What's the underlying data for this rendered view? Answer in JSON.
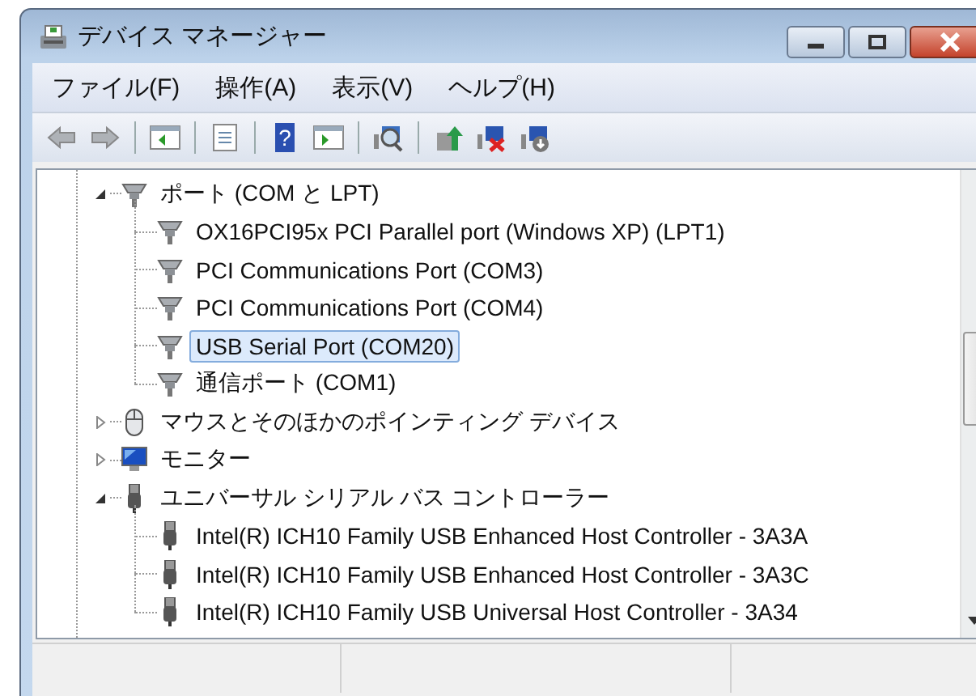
{
  "window": {
    "title": "デバイス マネージャー"
  },
  "menu": [
    {
      "label": "ファイル(F)"
    },
    {
      "label": "操作(A)"
    },
    {
      "label": "表示(V)"
    },
    {
      "label": "ヘルプ(H)"
    }
  ],
  "toolbar": [
    {
      "kind": "back",
      "disabled": true
    },
    {
      "kind": "forward",
      "disabled": true
    },
    {
      "kind": "sep"
    },
    {
      "kind": "tree-toggle",
      "disabled": false
    },
    {
      "kind": "sep"
    },
    {
      "kind": "properties",
      "disabled": false
    },
    {
      "kind": "sep"
    },
    {
      "kind": "help",
      "label": "?",
      "disabled": false
    },
    {
      "kind": "action-pane",
      "disabled": false
    },
    {
      "kind": "sep"
    },
    {
      "kind": "scan",
      "disabled": false
    },
    {
      "kind": "sep"
    },
    {
      "kind": "update",
      "disabled": false
    },
    {
      "kind": "uninstall",
      "disabled": false
    },
    {
      "kind": "disable",
      "disabled": false
    }
  ],
  "tree": [
    {
      "label": "ポート (COM と LPT)",
      "kind": "port",
      "expanded": true,
      "selected": false,
      "children": [
        {
          "label": "OX16PCI95x PCI Parallel port (Windows XP) (LPT1)",
          "kind": "port",
          "selected": false
        },
        {
          "label": "PCI Communications Port (COM3)",
          "kind": "port",
          "selected": false
        },
        {
          "label": "PCI Communications Port (COM4)",
          "kind": "port",
          "selected": false
        },
        {
          "label": "USB Serial Port (COM20)",
          "kind": "port",
          "selected": true
        },
        {
          "label": "通信ポート (COM1)",
          "kind": "port",
          "selected": false
        }
      ]
    },
    {
      "label": "マウスとそのほかのポインティング デバイス",
      "kind": "mouse",
      "expanded": false,
      "selected": false
    },
    {
      "label": "モニター",
      "kind": "monitor",
      "expanded": false,
      "selected": false
    },
    {
      "label": "ユニバーサル シリアル バス コントローラー",
      "kind": "usb",
      "expanded": true,
      "selected": false,
      "children": [
        {
          "label": "Intel(R) ICH10 Family USB Enhanced Host Controller - 3A3A",
          "kind": "usb",
          "selected": false
        },
        {
          "label": "Intel(R) ICH10 Family USB Enhanced Host Controller - 3A3C",
          "kind": "usb",
          "selected": false
        },
        {
          "label": "Intel(R) ICH10 Family USB Universal Host Controller - 3A34",
          "kind": "usb",
          "selected": false
        }
      ]
    }
  ]
}
